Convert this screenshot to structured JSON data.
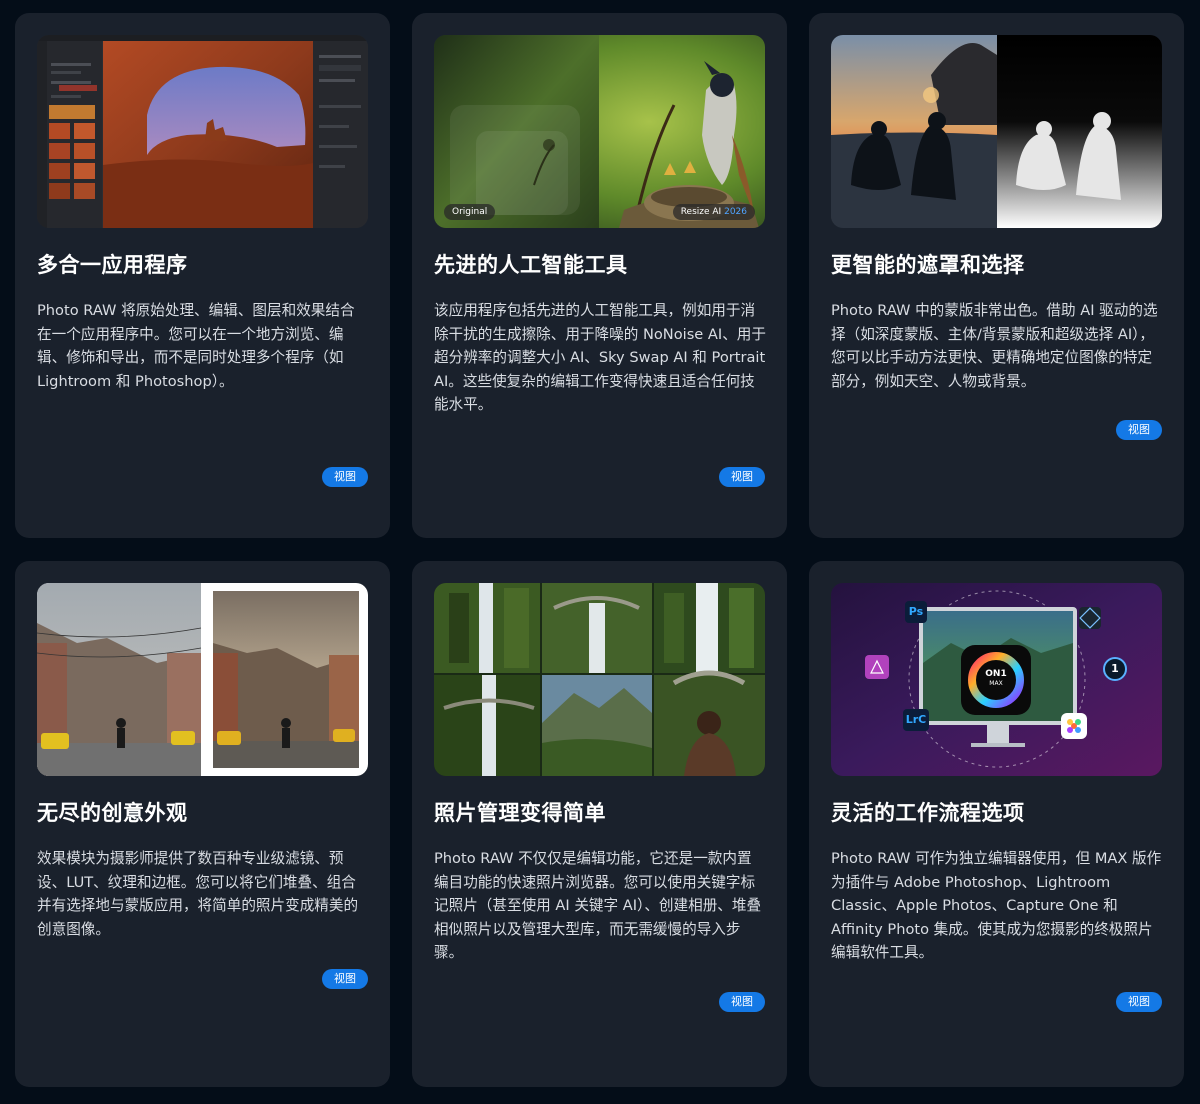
{
  "cards": [
    {
      "title": "多合一应用程序",
      "description": "Photo RAW 将原始处理、编辑、图层和效果结合在一个应用程序中。您可以在一个地方浏览、编辑、修饰和导出，而不是同时处理多个程序（如 Lightroom 和 Photoshop）。",
      "button": "视图"
    },
    {
      "title": "先进的人工智能工具",
      "description": "该应用程序包括先进的人工智能工具，例如用于消除干扰的生成擦除、用于降噪的 NoNoise AI、用于超分辨率的调整大小 AI、Sky Swap AI 和 Portrait AI。这些使复杂的编辑工作变得快速且适合任何技能水平。",
      "button": "视图",
      "image_labels": {
        "left": "Original",
        "right": "Resize AI",
        "right_accent": "2026"
      }
    },
    {
      "title": "更智能的遮罩和选择",
      "description": "Photo RAW 中的蒙版非常出色。借助 AI 驱动的选择（如深度蒙版、主体/背景蒙版和超级选择 AI），您可以比手动方法更快、更精确地定位图像的特定部分，例如天空、人物或背景。",
      "button": "视图"
    },
    {
      "title": "无尽的创意外观",
      "description": "效果模块为摄影师提供了数百种专业级滤镜、预设、LUT、纹理和边框。您可以将它们堆叠、组合并有选择地与蒙版应用，将简单的照片变成精美的创意图像。",
      "button": "视图"
    },
    {
      "title": "照片管理变得简单",
      "description": "Photo RAW 不仅仅是编辑功能，它还是一款内置编目功能的快速照片浏览器。您可以使用关键字标记照片（甚至使用 AI 关键字 AI）、创建相册、堆叠相似照片以及管理大型库，而无需缓慢的导入步骤。",
      "button": "视图"
    },
    {
      "title": "灵活的工作流程选项",
      "description": "Photo RAW 可作为独立编辑器使用，但 MAX 版作为插件与 Adobe Photoshop、Lightroom Classic、Apple Photos、Capture One 和 Affinity Photo 集成。使其成为您摄影的终极照片编辑软件工具。",
      "button": "视图",
      "image_labels": {
        "ps": "Ps",
        "lrc": "LrC",
        "badge_top": "ON1",
        "badge_bottom": "MAX",
        "badge_one": "1"
      }
    }
  ],
  "colors": {
    "page_bg": "#040d18",
    "card_bg": "#1a212c",
    "button": "#1479e6",
    "title": "#ffffff",
    "text": "#d9dde3"
  },
  "icons": [
    "ps-icon",
    "affinity-icon",
    "lrc-icon",
    "capture-one-icon",
    "one-icon",
    "apple-photos-icon",
    "on1-max-icon"
  ]
}
